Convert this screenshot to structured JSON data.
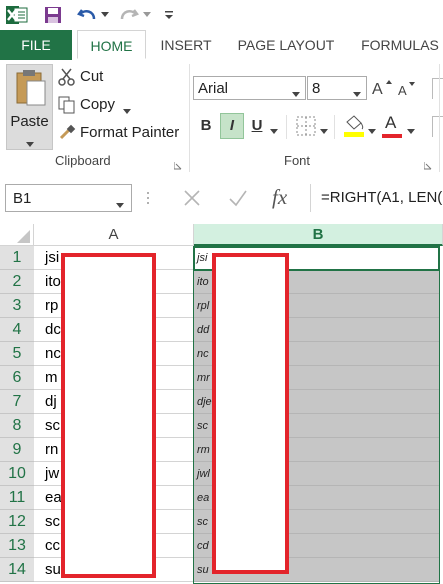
{
  "quick_access": {
    "save_icon": "save-icon",
    "undo_icon": "undo-icon",
    "redo_icon": "redo-icon"
  },
  "tabs": [
    {
      "label": "FILE"
    },
    {
      "label": "HOME"
    },
    {
      "label": "INSERT"
    },
    {
      "label": "PAGE LAYOUT"
    },
    {
      "label": "FORMULAS"
    }
  ],
  "clipboard": {
    "paste_label": "Paste",
    "cut_label": "Cut",
    "copy_label": "Copy",
    "format_painter_label": "Format Painter",
    "group_label": "Clipboard"
  },
  "font": {
    "name": "Arial",
    "size": "8",
    "bold": "B",
    "italic": "I",
    "underline": "U",
    "font_color": "A",
    "group_label": "Font"
  },
  "formula_bar": {
    "name_box": "B1",
    "fx": "fx",
    "formula": "=RIGHT(A1, LEN("
  },
  "columns": [
    "A",
    "B"
  ],
  "rows": [
    {
      "num": "1",
      "a": "jsi",
      "b": "jsi"
    },
    {
      "num": "2",
      "a": "ito",
      "b": "ito"
    },
    {
      "num": "3",
      "a": "rp",
      "b": "rpl"
    },
    {
      "num": "4",
      "a": "dc",
      "b": "dd"
    },
    {
      "num": "5",
      "a": "nc",
      "b": "nc"
    },
    {
      "num": "6",
      "a": "m",
      "b": "mr"
    },
    {
      "num": "7",
      "a": "dj",
      "b": "dje"
    },
    {
      "num": "8",
      "a": "sc",
      "b": "sc"
    },
    {
      "num": "9",
      "a": "rn",
      "b": "rm"
    },
    {
      "num": "10",
      "a": "jw",
      "b": "jwl"
    },
    {
      "num": "11",
      "a": "ea",
      "b": "ea"
    },
    {
      "num": "12",
      "a": "sc",
      "b": "sc"
    },
    {
      "num": "13",
      "a": "cc",
      "b": "cd"
    },
    {
      "num": "14",
      "a": "su",
      "b": "su"
    }
  ],
  "colors": {
    "excel_green": "#217346",
    "redaction_red": "#e3242b",
    "selection_gray": "#c6c6c6"
  }
}
